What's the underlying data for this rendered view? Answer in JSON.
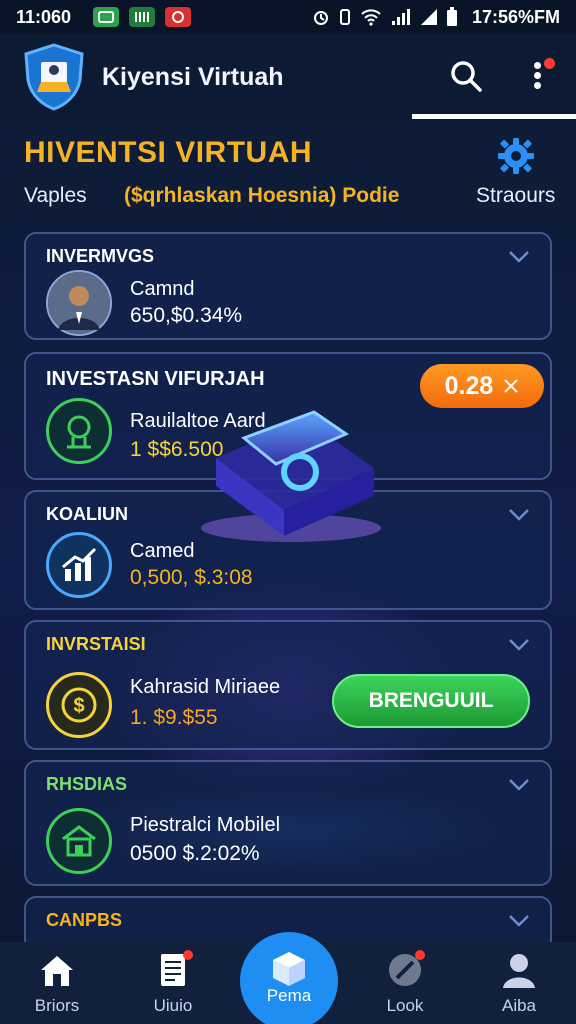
{
  "status_bar": {
    "time": "11:060",
    "clock": "17:56%FM"
  },
  "app_bar": {
    "title": "Kiyensi Virtuah"
  },
  "sub_header": {
    "title": "HIVENTSI VIRTUAH",
    "tabs": [
      {
        "label": "Vaples"
      },
      {
        "label": "($qrhlaskan Hoesnia) Podie"
      },
      {
        "label": "Straours"
      }
    ]
  },
  "cards": [
    {
      "label": "INVERMVGS",
      "label_color": "#ffffff",
      "name": "Camnd",
      "value": "650,$0.34%",
      "value_color": "#ffffff",
      "icon": "avatar-photo"
    },
    {
      "label": "INVESTASN VIFURJAH",
      "label_color": "#ffffff",
      "name": "Rauilaltoe Aard",
      "value": "1 $$6.500",
      "value_color": "#f5d43a",
      "icon": "shield-icon"
    },
    {
      "label": "KOALIUN",
      "label_color": "#ffffff",
      "name": "Camed",
      "value": "0,500, $.3:08",
      "value_color": "#f5b323",
      "icon": "chart-icon"
    },
    {
      "label": "INVRSTAISI",
      "label_color": "#f5d43a",
      "name": "Kahrasid Miriaee",
      "value": "1. $9.$55",
      "value_color": "#f5a623",
      "icon": "coin-icon"
    },
    {
      "label": "RHSDIAS",
      "label_color": "#7be36b",
      "name": "Piestralci Mobilel",
      "value": "0500 $.2:02%",
      "value_color": "#ffffff",
      "icon": "building-icon"
    },
    {
      "label": "CANPBS",
      "label_color": "#f5b323",
      "name": "",
      "value": "",
      "value_color": "#ffffff",
      "icon": "coin-icon"
    }
  ],
  "badge": {
    "label": "0.28",
    "icon": "close-icon"
  },
  "cta": {
    "label": "BRENGUUIL"
  },
  "bottom_nav": [
    {
      "label": "Briors",
      "icon": "home-icon"
    },
    {
      "label": "Uiuio",
      "icon": "document-icon"
    },
    {
      "label": "Pema",
      "icon": "box-icon"
    },
    {
      "label": "Look",
      "icon": "gauge-icon"
    },
    {
      "label": "Aiba",
      "icon": "user-icon"
    }
  ],
  "colors": {
    "accent": "#f5b323",
    "primary": "#1f8ef2",
    "badge": "#f58a1a",
    "cta": "#2fbf4c",
    "background": "#0b1730"
  }
}
